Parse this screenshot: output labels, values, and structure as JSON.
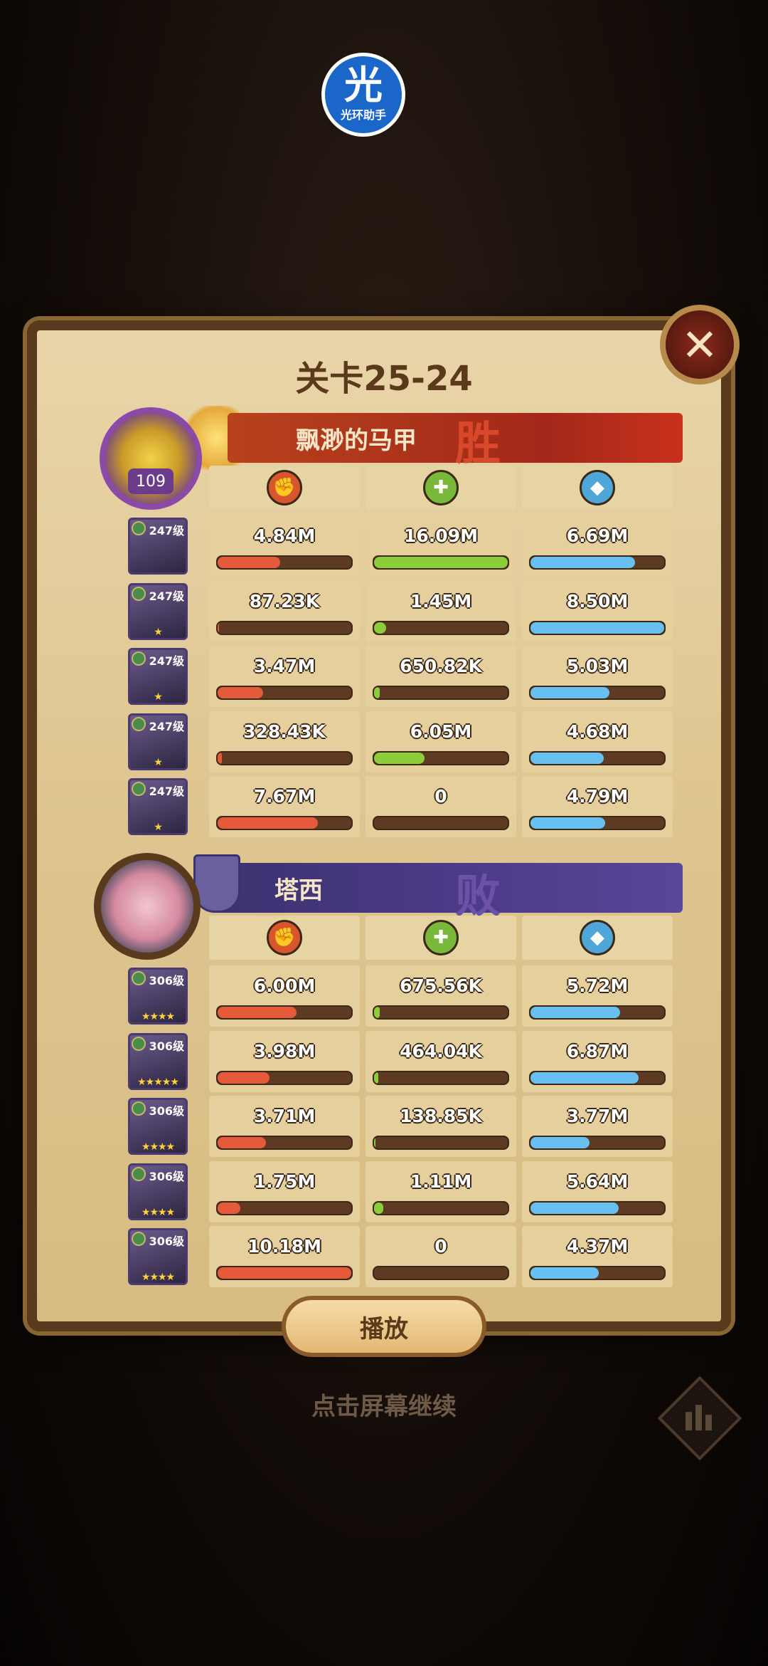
{
  "app": {
    "logo_big": "光",
    "logo_small": "光环助手"
  },
  "stage": {
    "title": "关卡25-24"
  },
  "close_icon": "✕",
  "colors": {
    "damage": "#e45a3a",
    "heal": "#8ccd3a",
    "shield": "#67c0ef"
  },
  "stat_icons": {
    "damage": "damage-icon",
    "heal": "heal-icon",
    "shield": "shield-icon"
  },
  "winner": {
    "name": "飘渺的马甲",
    "result": "胜",
    "level": "109",
    "heroes": [
      {
        "level": "247级",
        "stars": "",
        "damage": "4.84M",
        "heal": "16.09M",
        "shield": "6.69M",
        "damage_frac": 0.47,
        "heal_frac": 1.0,
        "shield_frac": 0.78
      },
      {
        "level": "247级",
        "stars": "★",
        "damage": "87.23K",
        "heal": "1.45M",
        "shield": "8.50M",
        "damage_frac": 0.01,
        "heal_frac": 0.09,
        "shield_frac": 1.0
      },
      {
        "level": "247级",
        "stars": "★",
        "damage": "3.47M",
        "heal": "650.82K",
        "shield": "5.03M",
        "damage_frac": 0.34,
        "heal_frac": 0.04,
        "shield_frac": 0.59
      },
      {
        "level": "247级",
        "stars": "★",
        "damage": "328.43K",
        "heal": "6.05M",
        "shield": "4.68M",
        "damage_frac": 0.03,
        "heal_frac": 0.38,
        "shield_frac": 0.55
      },
      {
        "level": "247级",
        "stars": "★",
        "damage": "7.67M",
        "heal": "0",
        "shield": "4.79M",
        "damage_frac": 0.75,
        "heal_frac": 0.0,
        "shield_frac": 0.56
      }
    ]
  },
  "loser": {
    "name": "塔西",
    "result": "败",
    "heroes": [
      {
        "level": "306级",
        "stars": "★★★★",
        "damage": "6.00M",
        "heal": "675.56K",
        "shield": "5.72M",
        "damage_frac": 0.59,
        "heal_frac": 0.04,
        "shield_frac": 0.67
      },
      {
        "level": "306级",
        "stars": "★★★★★",
        "damage": "3.98M",
        "heal": "464.04K",
        "shield": "6.87M",
        "damage_frac": 0.39,
        "heal_frac": 0.03,
        "shield_frac": 0.81
      },
      {
        "level": "306级",
        "stars": "★★★★",
        "damage": "3.71M",
        "heal": "138.85K",
        "shield": "3.77M",
        "damage_frac": 0.36,
        "heal_frac": 0.01,
        "shield_frac": 0.44
      },
      {
        "level": "306级",
        "stars": "★★★★",
        "damage": "1.75M",
        "heal": "1.11M",
        "shield": "5.64M",
        "damage_frac": 0.17,
        "heal_frac": 0.07,
        "shield_frac": 0.66
      },
      {
        "level": "306级",
        "stars": "★★★★",
        "damage": "10.18M",
        "heal": "0",
        "shield": "4.37M",
        "damage_frac": 1.0,
        "heal_frac": 0.0,
        "shield_frac": 0.51
      }
    ]
  },
  "play_button": "播放",
  "continue_hint": "点击屏幕继续"
}
